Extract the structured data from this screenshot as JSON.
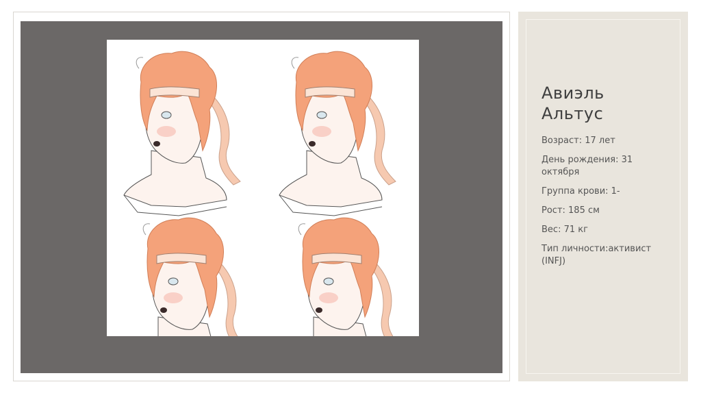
{
  "slide": {
    "title_line1": "Авиэль",
    "title_line2": "Альтус",
    "details": [
      "Возраст: 17 лет",
      "День рождения: 31 октября",
      "Группа крови: 1-",
      "Рост: 185 см",
      "Вес: 71 кг",
      "Тип личности:активист (INFJ)"
    ]
  },
  "colors": {
    "mat": "#6b6867",
    "panel": "#e9e5dd",
    "hair": "#f4a27a",
    "skin": "#fdf3ee",
    "ribbon": "#f6c9b0"
  },
  "artwork": {
    "subject": "character-sheet",
    "poses": 4
  }
}
